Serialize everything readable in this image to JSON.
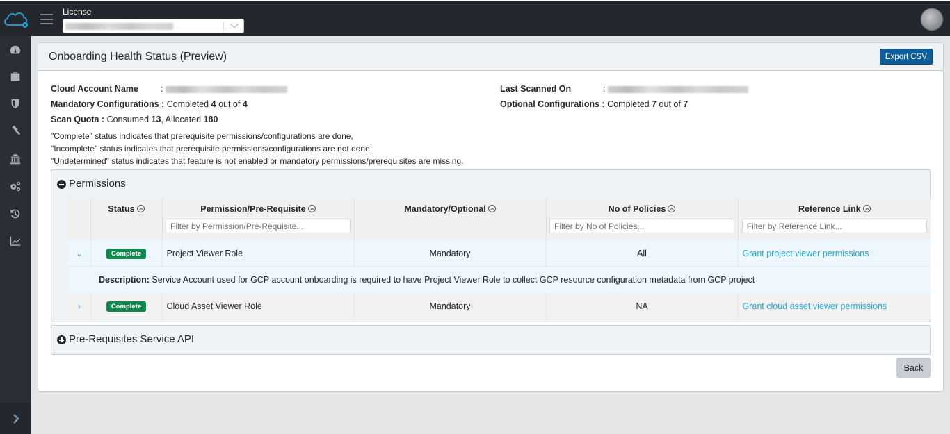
{
  "topbar": {
    "logo_icon": "cloud-gear-icon",
    "menu_icon": "hamburger-icon",
    "license_label": "License",
    "license_value": "[blurred]",
    "avatar_icon": "user-avatar"
  },
  "sidebar": {
    "items": [
      {
        "icon": "dashboard-icon"
      },
      {
        "icon": "briefcase-icon"
      },
      {
        "icon": "shield-icon"
      },
      {
        "icon": "gavel-icon"
      },
      {
        "icon": "bank-icon"
      },
      {
        "icon": "cogs-icon"
      },
      {
        "icon": "history-icon"
      },
      {
        "icon": "line-chart-icon"
      }
    ],
    "footer_icon": "chevron-right-icon"
  },
  "page": {
    "title": "Onboarding Health Status (Preview)",
    "export_label": "Export CSV",
    "back_label": "Back"
  },
  "summary": {
    "cloud_account_label": "Cloud Account Name",
    "cloud_account_sep": ":",
    "last_scanned_label": "Last Scanned On",
    "last_scanned_sep": ":",
    "mandatory_label": "Mandatory Configurations :",
    "mandatory_prefix": "Completed",
    "mandatory_done": "4",
    "mandatory_mid": "out of",
    "mandatory_total": "4",
    "optional_label": "Optional Configurations :",
    "optional_prefix": "Completed",
    "optional_done": "7",
    "optional_mid": "out of",
    "optional_total": "7",
    "quota_label": "Scan Quota :",
    "quota_consumed_prefix": "Consumed",
    "quota_consumed": "13",
    "quota_allocated_prefix": ", Allocated",
    "quota_allocated": "180"
  },
  "notes": [
    "\"Complete\" status indicates that prerequisite permissions/configurations are done,",
    "\"Incomplete\" status indicates that prerequisite permissions/configurations are not done.",
    "\"Undetermined\" status indicates that feature is not enabled or mandatory permissions/prerequisites are missing."
  ],
  "permissions_panel": {
    "title": "Permissions",
    "state": "expanded",
    "columns": [
      {
        "label": "Status",
        "filter_placeholder": ""
      },
      {
        "label": "Permission/Pre-Requisite",
        "filter_placeholder": "Filter by Permission/Pre-Requisite..."
      },
      {
        "label": "Mandatory/Optional",
        "filter_placeholder": ""
      },
      {
        "label": "No of Policies",
        "filter_placeholder": "Filter by No of Policies..."
      },
      {
        "label": "Reference Link",
        "filter_placeholder": "Filter by Reference Link..."
      }
    ],
    "rows": [
      {
        "expanded": true,
        "status": "Complete",
        "name": "Project Viewer Role",
        "requirement": "Mandatory",
        "policies": "All",
        "link": "Grant project viewer permissions",
        "description_label": "Description:",
        "description": "Service Account used for GCP account onboarding is required to have Project Viewer Role to collect GCP resource configuration metadata from GCP project"
      },
      {
        "expanded": false,
        "status": "Complete",
        "name": "Cloud Asset Viewer Role",
        "requirement": "Mandatory",
        "policies": "NA",
        "link": "Grant cloud asset viewer permissions"
      }
    ]
  },
  "service_api_panel": {
    "title": "Pre-Requisites Service API",
    "state": "collapsed"
  },
  "colors": {
    "topbar": "#24282e",
    "sidebar": "#2a2e35",
    "primary_button": "#0d5e99",
    "badge_complete": "#12884d",
    "link": "#20a8d8"
  }
}
